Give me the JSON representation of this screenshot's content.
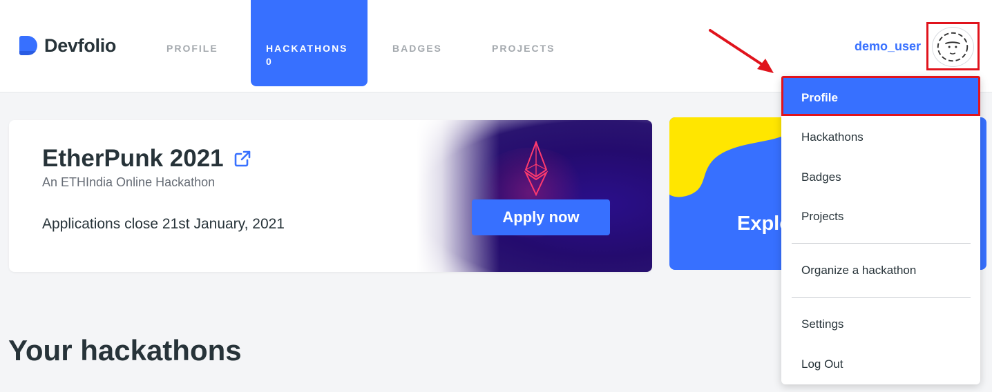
{
  "brand": {
    "name": "Devfolio"
  },
  "nav": {
    "tabs": [
      {
        "label": "PROFILE"
      },
      {
        "label": "HACKATHONS",
        "count": "0",
        "active": true
      },
      {
        "label": "BADGES"
      },
      {
        "label": "PROJECTS"
      }
    ]
  },
  "user": {
    "username": "demo_user",
    "avatar_icon": "avatar-face-icon"
  },
  "event": {
    "title": "EtherPunk 2021",
    "subtitle": "An ETHIndia Online Hackathon",
    "close_text": "Applications close 21st January, 2021",
    "apply_label": "Apply now"
  },
  "explore": {
    "label": "Explo"
  },
  "section": {
    "title": "Your hackathons"
  },
  "dropdown": {
    "items": [
      "Profile",
      "Hackathons",
      "Badges",
      "Projects",
      "Organize a hackathon",
      "Settings",
      "Log Out"
    ]
  },
  "colors": {
    "accent": "#3770ff",
    "highlight": "#e0131c",
    "explore_yellow": "#ffe600"
  }
}
